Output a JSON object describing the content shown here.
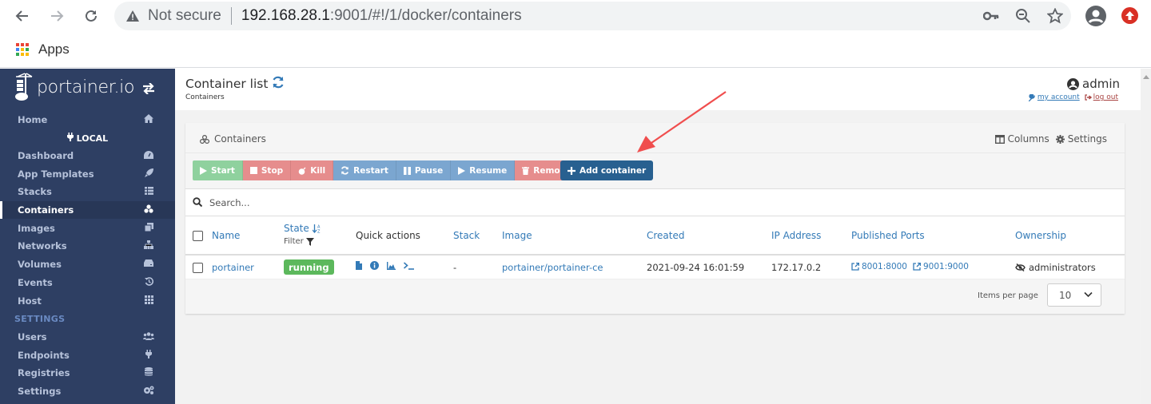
{
  "browser": {
    "security_label": "Not secure",
    "url_host": "192.168.28.1",
    "url_rest": ":9001/#!/1/docker/containers",
    "bookmarks": [
      {
        "label": "Apps"
      }
    ]
  },
  "sidebar": {
    "brand": "portainer.io",
    "home": {
      "label": "Home",
      "icon": "home-icon"
    },
    "endpoint_label": "LOCAL",
    "items": [
      {
        "label": "Dashboard",
        "icon": "tachometer-icon"
      },
      {
        "label": "App Templates",
        "icon": "rocket-icon"
      },
      {
        "label": "Stacks",
        "icon": "th-list-icon"
      },
      {
        "label": "Containers",
        "icon": "cubes-icon",
        "active": true
      },
      {
        "label": "Images",
        "icon": "clone-icon"
      },
      {
        "label": "Networks",
        "icon": "sitemap-icon"
      },
      {
        "label": "Volumes",
        "icon": "hdd-icon"
      },
      {
        "label": "Events",
        "icon": "history-icon"
      },
      {
        "label": "Host",
        "icon": "th-icon"
      }
    ],
    "settings_header": "SETTINGS",
    "settings_items": [
      {
        "label": "Users",
        "icon": "users-icon"
      },
      {
        "label": "Endpoints",
        "icon": "plug-icon"
      },
      {
        "label": "Registries",
        "icon": "database-icon"
      },
      {
        "label": "Settings",
        "icon": "cogs-icon"
      }
    ]
  },
  "header": {
    "title": "Container list",
    "breadcrumb": "Containers",
    "username": "admin",
    "my_account": "my account",
    "log_out": "log out"
  },
  "widget": {
    "title": "Containers",
    "columns_label": "Columns",
    "settings_label": "Settings",
    "actions": [
      {
        "label": "Start",
        "style": "success"
      },
      {
        "label": "Stop",
        "style": "danger"
      },
      {
        "label": "Kill",
        "style": "danger"
      },
      {
        "label": "Restart",
        "style": "primary"
      },
      {
        "label": "Pause",
        "style": "primary"
      },
      {
        "label": "Resume",
        "style": "primary"
      },
      {
        "label": "Remove",
        "style": "danger"
      }
    ],
    "add_label": "Add container",
    "search_placeholder": "Search...",
    "columns": {
      "name": "Name",
      "state": "State",
      "state_filter": "Filter",
      "quick_actions": "Quick actions",
      "stack": "Stack",
      "image": "Image",
      "created": "Created",
      "ip": "IP Address",
      "ports": "Published Ports",
      "ownership": "Ownership"
    },
    "rows": [
      {
        "name": "portainer",
        "state": "running",
        "stack": "-",
        "image": "portainer/portainer-ce",
        "created": "2021-09-24 16:01:59",
        "ip": "172.17.0.2",
        "ports": [
          "8001:8000",
          "9001:9000"
        ],
        "ownership": "administrators"
      }
    ],
    "items_per_page_label": "Items per page",
    "items_per_page": "10"
  },
  "colors": {
    "sidebar_bg": "#2e3f63",
    "link": "#337ab7",
    "running": "#5cb85c",
    "add_button": "#286090",
    "annotation_arrow": "#f04e4e"
  }
}
